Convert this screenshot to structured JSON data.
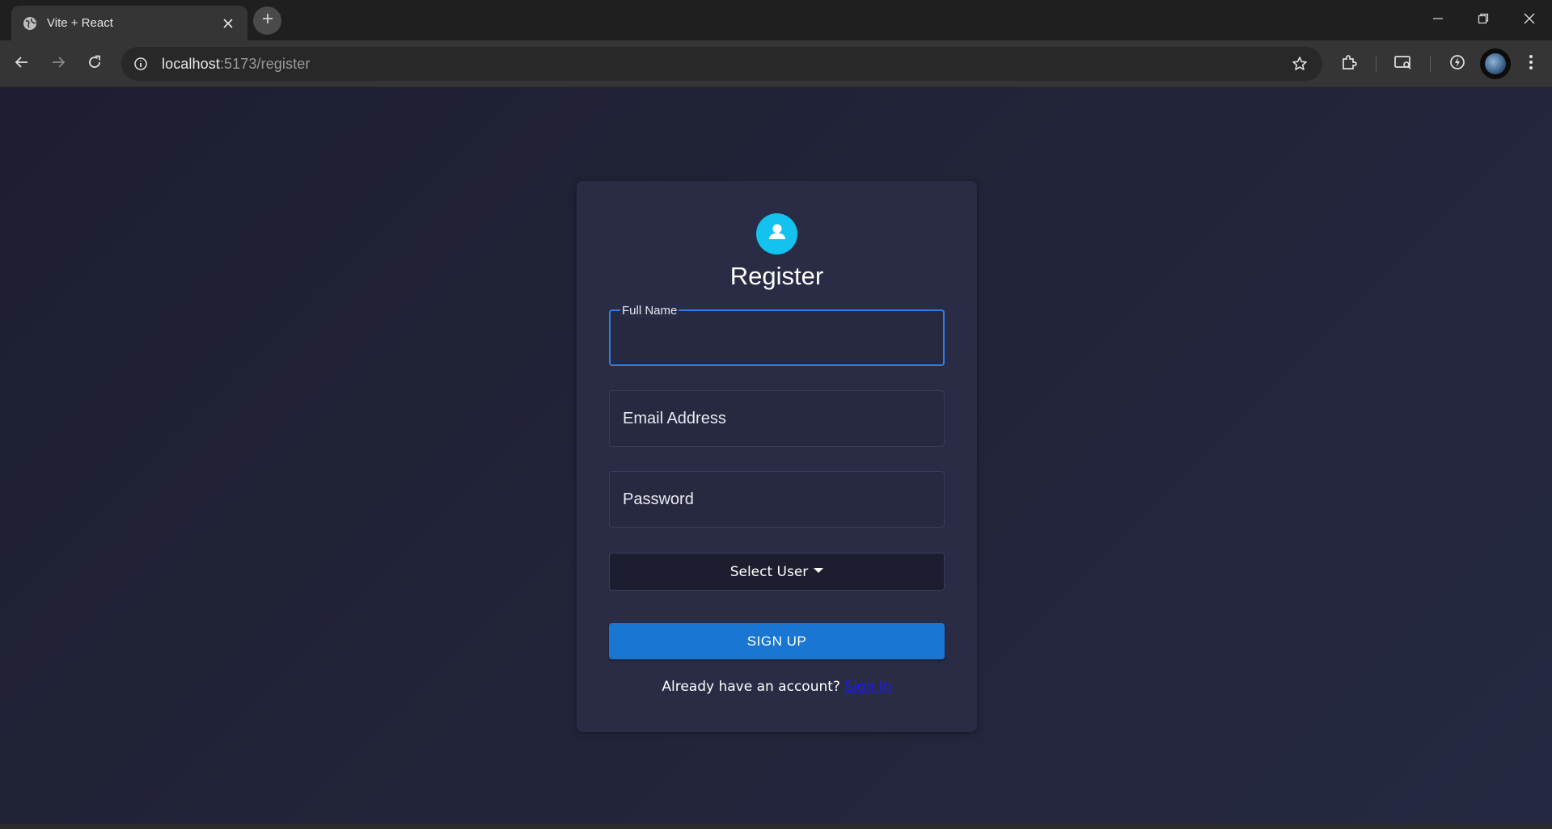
{
  "browser": {
    "tab_title": "Vite + React",
    "url_host": "localhost",
    "url_path": ":5173/register"
  },
  "register": {
    "title": "Register",
    "full_name_label": "Full Name",
    "full_name_value": "",
    "email_placeholder": "Email Address",
    "password_placeholder": "Password",
    "select_user_label": "Select User",
    "signup_label": "SIGN UP",
    "signin_prompt": "Already have an account?",
    "signin_link": "Sign In"
  },
  "colors": {
    "accent": "#1976d2",
    "avatar": "#13c2ee",
    "card": "#2a2c45",
    "page": "#222439"
  },
  "icons": [
    "globe-icon",
    "close-icon",
    "plus-icon",
    "minimize-icon",
    "restore-icon",
    "window-close-icon",
    "back-icon",
    "forward-icon",
    "reload-icon",
    "info-icon",
    "star-icon",
    "extensions-icon",
    "cast-icon",
    "performance-icon",
    "menu-icon",
    "person-icon"
  ]
}
